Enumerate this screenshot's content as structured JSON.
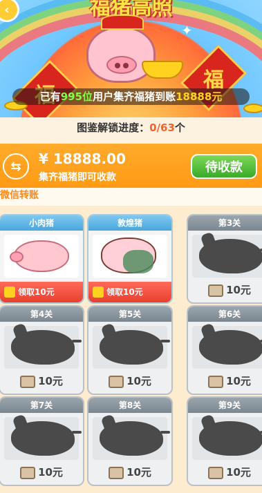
{
  "banner": {
    "title": "福猪高照",
    "back_icon": "back-arrow-icon",
    "couplet_left": "福",
    "couplet_right": "福",
    "users_prefix": "已有",
    "users_count": "995位",
    "users_mid": "用户集齐福猪到账",
    "users_amount": "18888元"
  },
  "progress": {
    "label": "图鉴解锁进度：",
    "value": "0/63",
    "unit": "个"
  },
  "cash": {
    "exchange_icon": "exchange-arrows-icon",
    "amount": "¥ 18888.00",
    "subtitle": "集齐福猪即可收款",
    "pending_label": "待收款"
  },
  "wechat_label": "微信转账",
  "cards": [
    {
      "title": "小肉猪",
      "state": "unlocked",
      "claim": "领取10元",
      "art": "pink-pig"
    },
    {
      "title": "敦煌猪",
      "state": "unlocked",
      "claim": "领取10元",
      "art": "dunhuang-pig"
    },
    {
      "title": "第3关",
      "state": "locked",
      "reward": "10元"
    },
    {
      "title": "第4关",
      "state": "locked",
      "reward": "10元"
    },
    {
      "title": "第5关",
      "state": "locked",
      "reward": "10元"
    },
    {
      "title": "第6关",
      "state": "locked",
      "reward": "10元"
    },
    {
      "title": "第7关",
      "state": "locked",
      "reward": "10元"
    },
    {
      "title": "第8关",
      "state": "locked",
      "reward": "10元"
    },
    {
      "title": "第9关",
      "state": "locked",
      "reward": "10元"
    }
  ]
}
